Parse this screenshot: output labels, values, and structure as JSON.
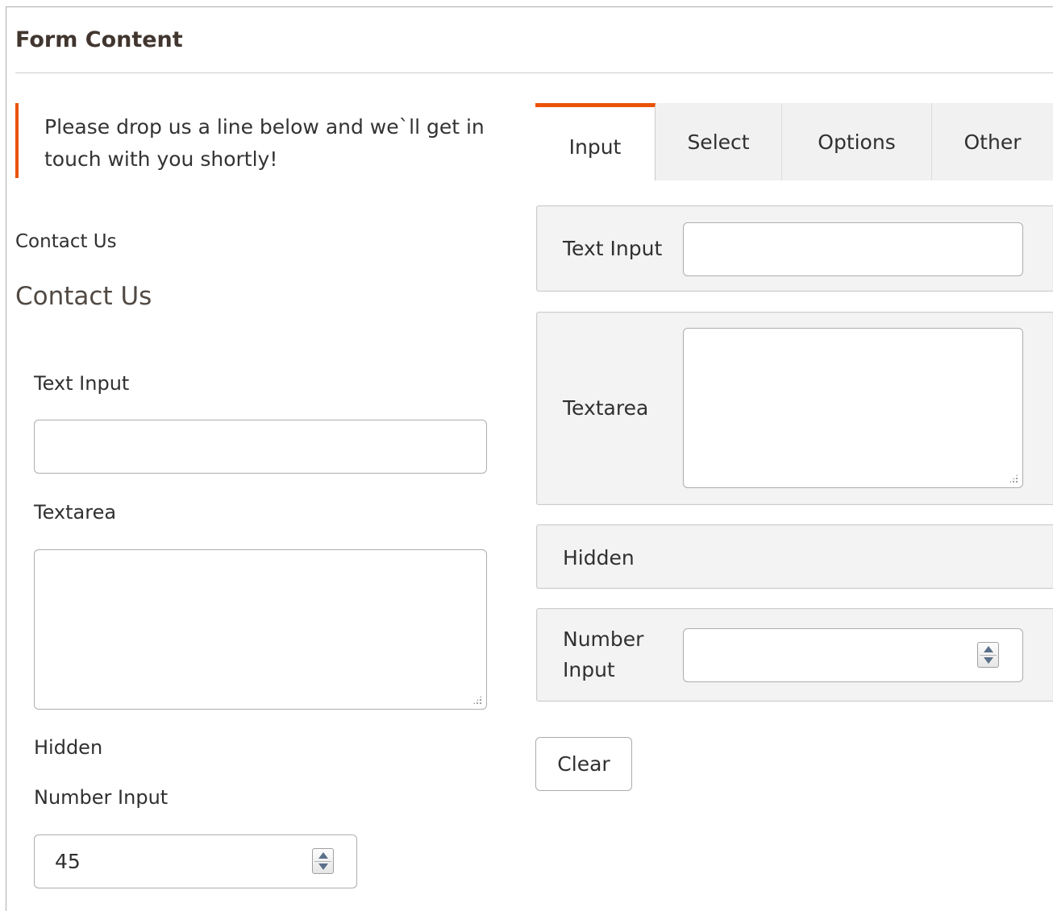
{
  "section": {
    "title": "Form Content"
  },
  "notice": {
    "text": "Please drop us a line below and we`ll get in touch with you shortly!",
    "accent_color": "#eb5202"
  },
  "preview": {
    "form_label": "Contact Us",
    "form_heading": "Contact Us",
    "text_input_label": "Text Input",
    "textarea_label": "Textarea",
    "hidden_label": "Hidden",
    "number_input_label": "Number Input",
    "number_input_value": "45"
  },
  "tabs": [
    {
      "label": "Input",
      "active": true
    },
    {
      "label": "Select",
      "active": false
    },
    {
      "label": "Options",
      "active": false
    },
    {
      "label": "Other",
      "active": false
    }
  ],
  "config_panels": {
    "text_input_label": "Text Input",
    "textarea_label": "Textarea",
    "hidden_label": "Hidden",
    "number_input_label": "Number Input"
  },
  "actions": {
    "clear_label": "Clear"
  },
  "icons": {
    "spinner": "spinner-arrows-icon",
    "resize": "resize-grip-icon"
  }
}
